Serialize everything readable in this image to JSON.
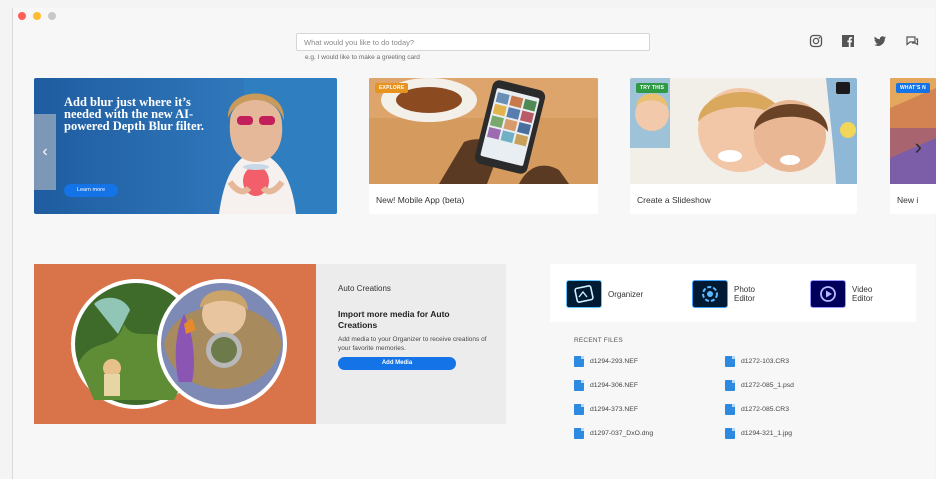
{
  "window": {
    "traffic_lights": [
      "close",
      "minimize",
      "zoom"
    ],
    "traffic_colors": [
      "#ff5f57",
      "#febc2e",
      "#c8c8c8"
    ]
  },
  "search": {
    "placeholder": "What would you like to do today?",
    "hint": "e.g. I would like to make a greeting card"
  },
  "social": {
    "icons": [
      "instagram-icon",
      "facebook-icon",
      "twitter-icon",
      "feedback-icon"
    ]
  },
  "carousel": {
    "hero": {
      "title": "Add blur just where it’s needed with the new AI-powered Depth Blur filter.",
      "button": "Learn more"
    },
    "cards": [
      {
        "badge": "EXPLORE",
        "badge_color": "#e7931f",
        "caption": "New! Mobile App (beta)"
      },
      {
        "badge": "TRY THIS",
        "badge_color": "#2f9a45",
        "caption": "Create a Slideshow"
      },
      {
        "badge": "WHAT’S N",
        "badge_color": "#1473e6",
        "caption": "New i"
      }
    ]
  },
  "auto_creations": {
    "title": "Auto Creations",
    "headline": "Import more media for Auto Creations",
    "body": "Add media to your Organizer to receive creations of your favorite memories.",
    "button": "Add Media"
  },
  "apps": [
    {
      "name": "Organizer"
    },
    {
      "name": "Photo\nEditor"
    },
    {
      "name": "Video\nEditor"
    }
  ],
  "recent_files": {
    "title": "RECENT FILES",
    "items": [
      "d1294-293.NEF",
      "d1272-103.CR3",
      "d1294-306.NEF",
      "d1272-085_1.psd",
      "d1294-373.NEF",
      "d1272-085.CR3",
      "d1297-037_DxO.dng",
      "d1294-321_1.jpg"
    ]
  }
}
